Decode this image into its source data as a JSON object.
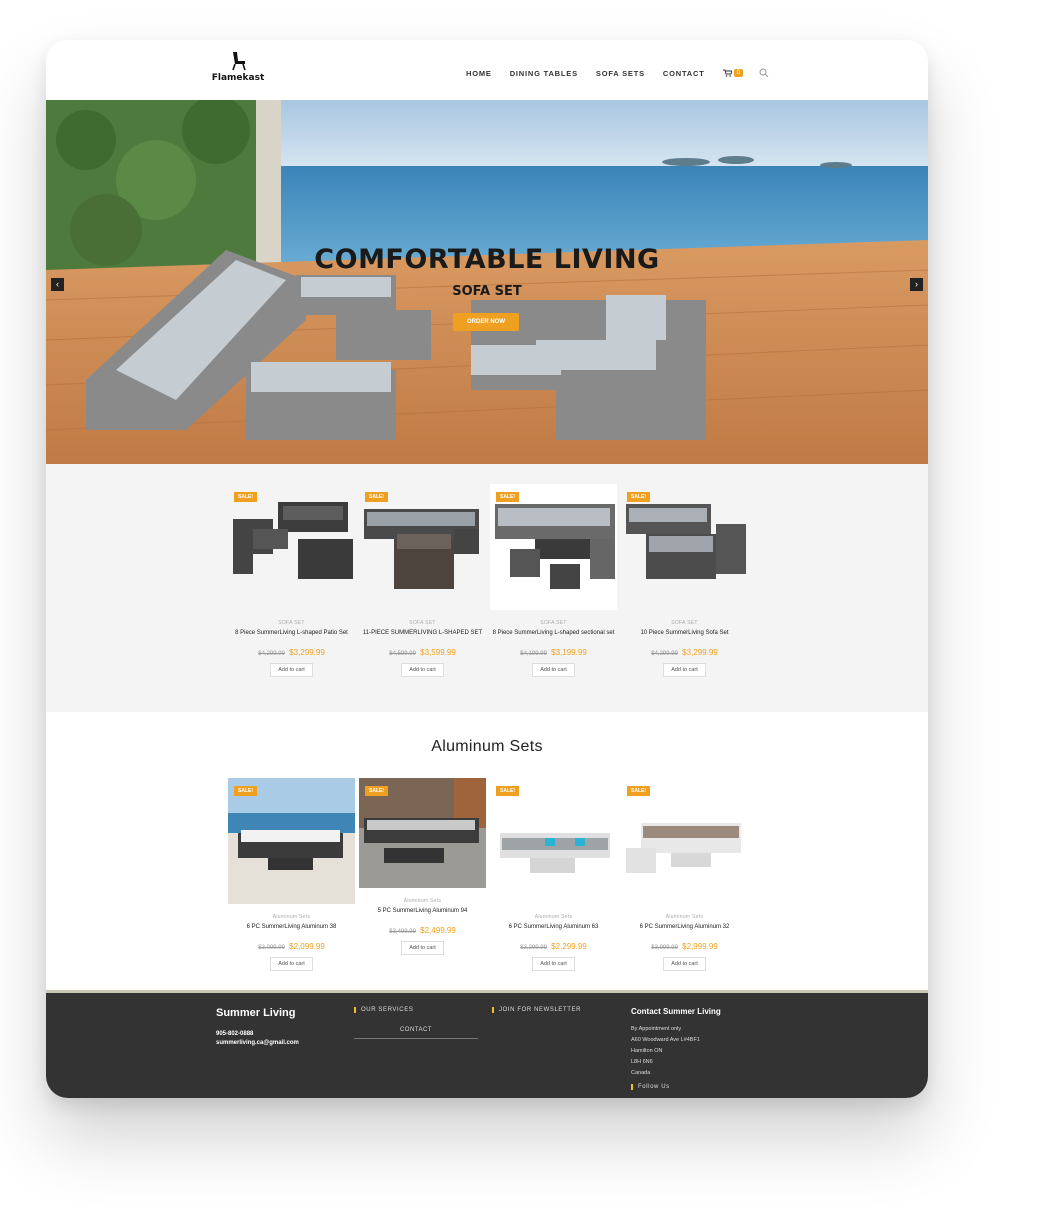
{
  "header": {
    "logo_text": "Flamekast",
    "nav": [
      "HOME",
      "DINING TABLES",
      "SOFA SETS",
      "CONTACT"
    ],
    "cart_count": "0"
  },
  "hero": {
    "title": "COMFORTABLE LIVING",
    "subtitle": "SOFA SET",
    "button": "ORDER NOW"
  },
  "sofa_products": [
    {
      "badge": "SALE!",
      "category": "SOFA SET",
      "name": "8 Piece SummerLiving L-shaped Patio Set",
      "old_price": "$4,299.99",
      "price": "$3,299.99",
      "button": "Add to cart"
    },
    {
      "badge": "SALE!",
      "category": "SOFA SET",
      "name": "11-PIECE SUMMERLIVING L-SHAPED SET",
      "old_price": "$4,599.99",
      "price": "$3,599.99",
      "button": "Add to cart"
    },
    {
      "badge": "SALE!",
      "category": "SOFA SET",
      "name": "8 Piece SummerLiving L-shaped sectional set",
      "old_price": "$4,199.99",
      "price": "$3,199.99",
      "button": "Add to cart"
    },
    {
      "badge": "SALE!",
      "category": "SOFA SET",
      "name": "10 Piece SummerLiving Sofa Set",
      "old_price": "$4,299.99",
      "price": "$3,299.99",
      "button": "Add to cart"
    }
  ],
  "aluminum": {
    "title": "Aluminum Sets",
    "products": [
      {
        "badge": "SALE!",
        "category": "Aluminum Sets",
        "name": "6 PC SummerLiving Aluminum 38",
        "old_price": "$3,099.99",
        "price": "$2,099.99",
        "button": "Add to cart"
      },
      {
        "badge": "SALE!",
        "category": "Aluminum Sets",
        "name": "5 PC SummerLiving Aluminum 94",
        "old_price": "$3,499.99",
        "price": "$2,499.99",
        "button": "Add to cart"
      },
      {
        "badge": "SALE!",
        "category": "Aluminum Sets",
        "name": "6 PC SummerLiving Aluminum 63",
        "old_price": "$3,299.99",
        "price": "$2,299.99",
        "button": "Add to cart"
      },
      {
        "badge": "SALE!",
        "category": "Aluminum Sets",
        "name": "6 PC SummerLiving Aluminum 32",
        "old_price": "$3,999.99",
        "price": "$2,999.99",
        "button": "Add to cart"
      }
    ]
  },
  "footer": {
    "brand": "Summer Living",
    "phone": "905-802-0888",
    "email": "summerliving.ca@gmail.com",
    "services_head": "OUR SERVICES",
    "services_link": "CONTACT",
    "newsletter_head": "JOIN FOR NEWSLETTER",
    "contact_title": "Contact Summer Living",
    "contact_lines": [
      "By Appointment only",
      "A60 Woodward Ave L#4BF1",
      "Hamilton ON",
      "L8H 6N6",
      "Canada"
    ],
    "follow": "Follow Us"
  },
  "colors": {
    "accent": "#f0a020",
    "footer_bg": "#333333",
    "section_bg": "#f4f4f4"
  }
}
